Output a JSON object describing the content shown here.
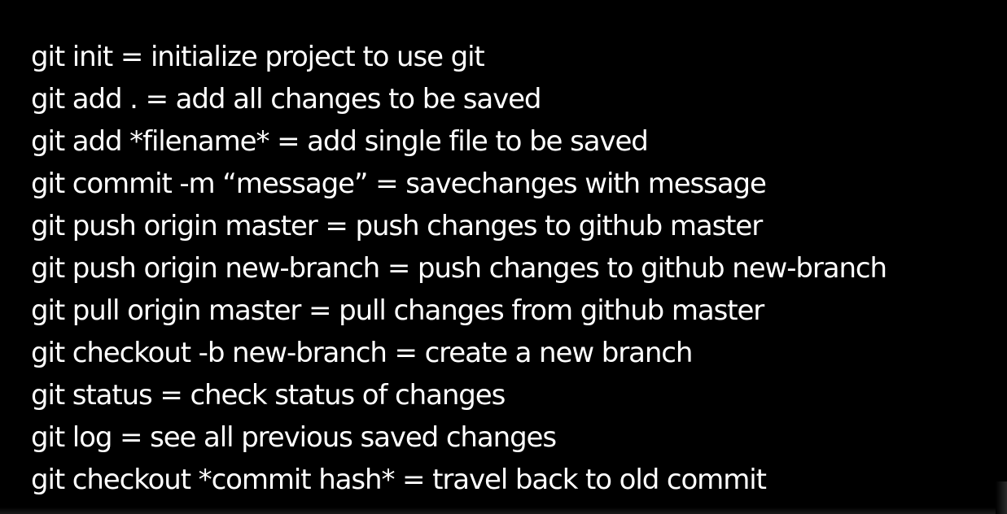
{
  "lines": [
    "git init = initialize project to use git",
    "git add . = add all changes to be saved",
    "git add *filename* = add single file to be saved",
    "git commit -m “message” = savechanges with message",
    "git push origin master = push changes to github master",
    "git push origin new-branch = push changes to github new-branch",
    "git pull origin master = pull changes from github master",
    "git checkout -b new-branch = create a new branch",
    "git status = check status of changes",
    "git log = see all previous saved changes",
    "git checkout *commit hash* = travel back to old commit"
  ],
  "colors": {
    "background": "#000000",
    "text": "#ffffff"
  }
}
